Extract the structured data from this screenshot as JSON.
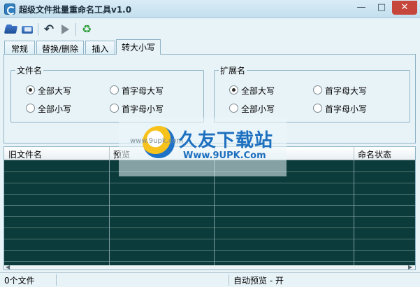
{
  "window": {
    "title": "超级文件批量重命名工具v1.0",
    "controls": {
      "minimize": "—",
      "maximize": "□",
      "close": "✕"
    }
  },
  "toolbar": {
    "icons": [
      "open-files-icon",
      "open-folder-icon",
      "undo-icon",
      "run-icon",
      "recycle-icon"
    ],
    "undo_glyph": "↶",
    "recycle_glyph": "♻"
  },
  "tabs": [
    {
      "label": "常规",
      "active": false
    },
    {
      "label": "替换/删除",
      "active": false
    },
    {
      "label": "插入",
      "active": false
    },
    {
      "label": "转大小写",
      "active": true
    }
  ],
  "case_panel": {
    "file_name": {
      "legend": "文件名",
      "options": [
        {
          "label": "全部大写",
          "checked": true
        },
        {
          "label": "首字母大写",
          "checked": false
        },
        {
          "label": "全部小写",
          "checked": false
        },
        {
          "label": "首字母小写",
          "checked": false
        }
      ]
    },
    "extension": {
      "legend": "扩展名",
      "options": [
        {
          "label": "全部大写",
          "checked": true
        },
        {
          "label": "首字母大写",
          "checked": false
        },
        {
          "label": "全部小写",
          "checked": false
        },
        {
          "label": "首字母小写",
          "checked": false
        }
      ]
    }
  },
  "table": {
    "columns": [
      "旧文件名",
      "预览",
      "",
      "命名状态"
    ],
    "rows": []
  },
  "status_bar": {
    "file_count": "0个文件",
    "preview_mode": "自动预览 - 开"
  },
  "watermark": {
    "title": "久友下载站",
    "url": "Www.9UPK.Com",
    "small": "www.9upk.com"
  },
  "colors": {
    "table_background": "#0b3b3a",
    "window_background": "#e8f3f8",
    "close_button": "#c7463c",
    "watermark_blue": "#1d6fbf"
  }
}
